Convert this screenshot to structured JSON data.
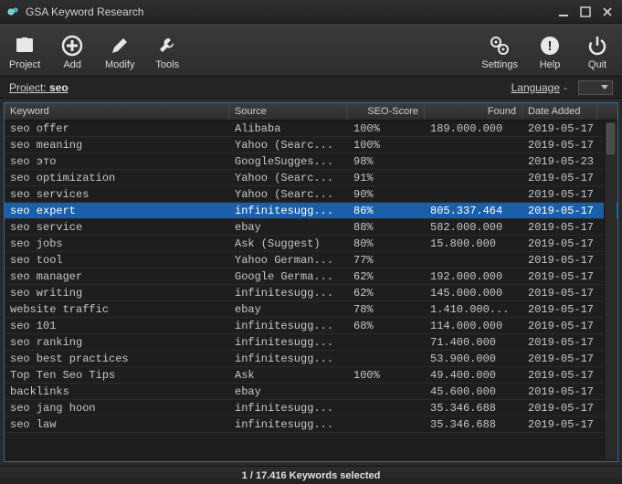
{
  "window": {
    "title": "GSA Keyword Research"
  },
  "toolbar": {
    "project": "Project",
    "add": "Add",
    "modify": "Modify",
    "tools": "Tools",
    "settings": "Settings",
    "help": "Help",
    "quit": "Quit"
  },
  "linkbar": {
    "project_label": "Project:",
    "project_value": "seo",
    "language_label": "Language",
    "language_value": "-"
  },
  "columns": {
    "keyword": "Keyword",
    "source": "Source",
    "score": "SEO-Score",
    "found": "Found",
    "date": "Date Added"
  },
  "rows": [
    {
      "keyword": "seo offer",
      "source": "Alibaba",
      "score": "100%",
      "found": "189.000.000",
      "date": "2019-05-17",
      "selected": false
    },
    {
      "keyword": "seo meaning",
      "source": "Yahoo (Searc...",
      "score": "100%",
      "found": "",
      "date": "2019-05-17",
      "selected": false
    },
    {
      "keyword": "seo это",
      "source": "GoogleSugges...",
      "score": "98%",
      "found": "",
      "date": "2019-05-23",
      "selected": false
    },
    {
      "keyword": "seo optimization",
      "source": "Yahoo (Searc...",
      "score": "91%",
      "found": "",
      "date": "2019-05-17",
      "selected": false
    },
    {
      "keyword": "seo services",
      "source": "Yahoo (Searc...",
      "score": "90%",
      "found": "",
      "date": "2019-05-17",
      "selected": false
    },
    {
      "keyword": "seo expert",
      "source": "infinitesugg...",
      "score": "86%",
      "found": "805.337.464",
      "date": "2019-05-17",
      "selected": true
    },
    {
      "keyword": "seo service",
      "source": "ebay",
      "score": "88%",
      "found": "582.000.000",
      "date": "2019-05-17",
      "selected": false
    },
    {
      "keyword": "seo jobs",
      "source": "Ask (Suggest)",
      "score": "80%",
      "found": "15.800.000",
      "date": "2019-05-17",
      "selected": false
    },
    {
      "keyword": "seo tool",
      "source": "Yahoo German...",
      "score": "77%",
      "found": "",
      "date": "2019-05-17",
      "selected": false
    },
    {
      "keyword": "seo manager",
      "source": "Google Germa...",
      "score": "62%",
      "found": "192.000.000",
      "date": "2019-05-17",
      "selected": false
    },
    {
      "keyword": "seo writing",
      "source": "infinitesugg...",
      "score": "62%",
      "found": "145.000.000",
      "date": "2019-05-17",
      "selected": false
    },
    {
      "keyword": "website traffic",
      "source": "ebay",
      "score": "78%",
      "found": "1.410.000...",
      "date": "2019-05-17",
      "selected": false
    },
    {
      "keyword": "seo 101",
      "source": "infinitesugg...",
      "score": "68%",
      "found": "114.000.000",
      "date": "2019-05-17",
      "selected": false
    },
    {
      "keyword": "seo ranking",
      "source": "infinitesugg...",
      "score": "",
      "found": "71.400.000",
      "date": "2019-05-17",
      "selected": false
    },
    {
      "keyword": "seo best practices",
      "source": "infinitesugg...",
      "score": "",
      "found": "53.900.000",
      "date": "2019-05-17",
      "selected": false
    },
    {
      "keyword": "Top Ten Seo Tips",
      "source": "Ask",
      "score": "100%",
      "found": "49.400.000",
      "date": "2019-05-17",
      "selected": false
    },
    {
      "keyword": "backlinks",
      "source": "ebay",
      "score": "",
      "found": "45.600.000",
      "date": "2019-05-17",
      "selected": false
    },
    {
      "keyword": "seo jang hoon",
      "source": "infinitesugg...",
      "score": "",
      "found": "35.346.688",
      "date": "2019-05-17",
      "selected": false
    },
    {
      "keyword": "seo law",
      "source": "infinitesugg...",
      "score": "",
      "found": "35.346.688",
      "date": "2019-05-17",
      "selected": false
    }
  ],
  "status": "1 / 17.416 Keywords selected"
}
